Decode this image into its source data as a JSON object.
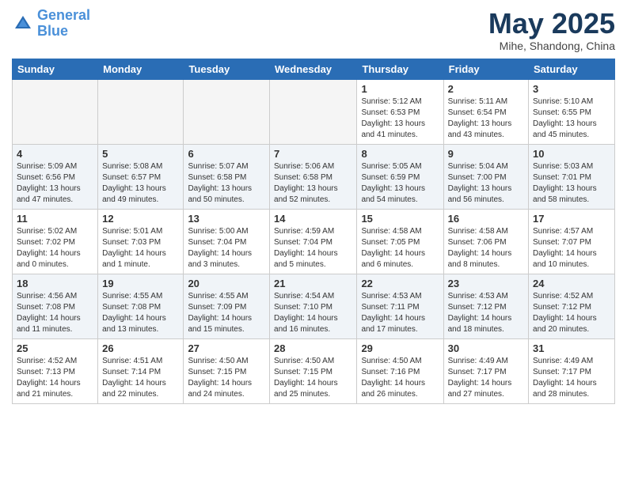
{
  "header": {
    "logo_line1": "General",
    "logo_line2": "Blue",
    "month": "May 2025",
    "location": "Mihe, Shandong, China"
  },
  "weekdays": [
    "Sunday",
    "Monday",
    "Tuesday",
    "Wednesday",
    "Thursday",
    "Friday",
    "Saturday"
  ],
  "weeks": [
    [
      {
        "day": "",
        "empty": true
      },
      {
        "day": "",
        "empty": true
      },
      {
        "day": "",
        "empty": true
      },
      {
        "day": "",
        "empty": true
      },
      {
        "day": "1",
        "sunrise": "5:12 AM",
        "sunset": "6:53 PM",
        "daylight": "13 hours and 41 minutes."
      },
      {
        "day": "2",
        "sunrise": "5:11 AM",
        "sunset": "6:54 PM",
        "daylight": "13 hours and 43 minutes."
      },
      {
        "day": "3",
        "sunrise": "5:10 AM",
        "sunset": "6:55 PM",
        "daylight": "13 hours and 45 minutes."
      }
    ],
    [
      {
        "day": "4",
        "sunrise": "5:09 AM",
        "sunset": "6:56 PM",
        "daylight": "13 hours and 47 minutes."
      },
      {
        "day": "5",
        "sunrise": "5:08 AM",
        "sunset": "6:57 PM",
        "daylight": "13 hours and 49 minutes."
      },
      {
        "day": "6",
        "sunrise": "5:07 AM",
        "sunset": "6:58 PM",
        "daylight": "13 hours and 50 minutes."
      },
      {
        "day": "7",
        "sunrise": "5:06 AM",
        "sunset": "6:58 PM",
        "daylight": "13 hours and 52 minutes."
      },
      {
        "day": "8",
        "sunrise": "5:05 AM",
        "sunset": "6:59 PM",
        "daylight": "13 hours and 54 minutes."
      },
      {
        "day": "9",
        "sunrise": "5:04 AM",
        "sunset": "7:00 PM",
        "daylight": "13 hours and 56 minutes."
      },
      {
        "day": "10",
        "sunrise": "5:03 AM",
        "sunset": "7:01 PM",
        "daylight": "13 hours and 58 minutes."
      }
    ],
    [
      {
        "day": "11",
        "sunrise": "5:02 AM",
        "sunset": "7:02 PM",
        "daylight": "14 hours and 0 minutes."
      },
      {
        "day": "12",
        "sunrise": "5:01 AM",
        "sunset": "7:03 PM",
        "daylight": "14 hours and 1 minute."
      },
      {
        "day": "13",
        "sunrise": "5:00 AM",
        "sunset": "7:04 PM",
        "daylight": "14 hours and 3 minutes."
      },
      {
        "day": "14",
        "sunrise": "4:59 AM",
        "sunset": "7:04 PM",
        "daylight": "14 hours and 5 minutes."
      },
      {
        "day": "15",
        "sunrise": "4:58 AM",
        "sunset": "7:05 PM",
        "daylight": "14 hours and 6 minutes."
      },
      {
        "day": "16",
        "sunrise": "4:58 AM",
        "sunset": "7:06 PM",
        "daylight": "14 hours and 8 minutes."
      },
      {
        "day": "17",
        "sunrise": "4:57 AM",
        "sunset": "7:07 PM",
        "daylight": "14 hours and 10 minutes."
      }
    ],
    [
      {
        "day": "18",
        "sunrise": "4:56 AM",
        "sunset": "7:08 PM",
        "daylight": "14 hours and 11 minutes."
      },
      {
        "day": "19",
        "sunrise": "4:55 AM",
        "sunset": "7:08 PM",
        "daylight": "14 hours and 13 minutes."
      },
      {
        "day": "20",
        "sunrise": "4:55 AM",
        "sunset": "7:09 PM",
        "daylight": "14 hours and 15 minutes."
      },
      {
        "day": "21",
        "sunrise": "4:54 AM",
        "sunset": "7:10 PM",
        "daylight": "14 hours and 16 minutes."
      },
      {
        "day": "22",
        "sunrise": "4:53 AM",
        "sunset": "7:11 PM",
        "daylight": "14 hours and 17 minutes."
      },
      {
        "day": "23",
        "sunrise": "4:53 AM",
        "sunset": "7:12 PM",
        "daylight": "14 hours and 18 minutes."
      },
      {
        "day": "24",
        "sunrise": "4:52 AM",
        "sunset": "7:12 PM",
        "daylight": "14 hours and 20 minutes."
      }
    ],
    [
      {
        "day": "25",
        "sunrise": "4:52 AM",
        "sunset": "7:13 PM",
        "daylight": "14 hours and 21 minutes."
      },
      {
        "day": "26",
        "sunrise": "4:51 AM",
        "sunset": "7:14 PM",
        "daylight": "14 hours and 22 minutes."
      },
      {
        "day": "27",
        "sunrise": "4:50 AM",
        "sunset": "7:15 PM",
        "daylight": "14 hours and 24 minutes."
      },
      {
        "day": "28",
        "sunrise": "4:50 AM",
        "sunset": "7:15 PM",
        "daylight": "14 hours and 25 minutes."
      },
      {
        "day": "29",
        "sunrise": "4:50 AM",
        "sunset": "7:16 PM",
        "daylight": "14 hours and 26 minutes."
      },
      {
        "day": "30",
        "sunrise": "4:49 AM",
        "sunset": "7:17 PM",
        "daylight": "14 hours and 27 minutes."
      },
      {
        "day": "31",
        "sunrise": "4:49 AM",
        "sunset": "7:17 PM",
        "daylight": "14 hours and 28 minutes."
      }
    ]
  ]
}
